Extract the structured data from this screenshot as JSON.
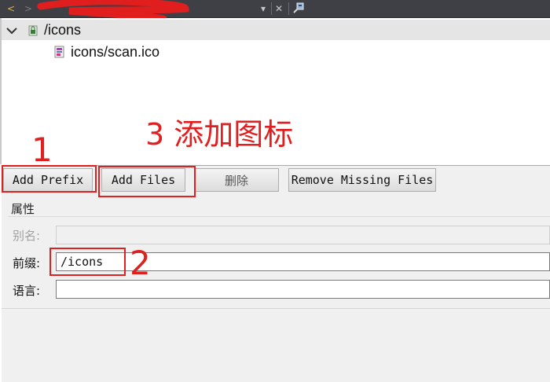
{
  "toolbar": {
    "back_glyph": "<",
    "forward_glyph": ">",
    "dropdown_glyph": "▾",
    "close_glyph": "✕"
  },
  "tree": {
    "prefix_label": "/icons",
    "file_label": "icons/scan.ico"
  },
  "buttons": {
    "add_prefix": "Add Prefix",
    "add_files": "Add Files",
    "delete": "删除",
    "remove_missing": "Remove Missing Files"
  },
  "properties": {
    "title": "属性",
    "alias_label": "别名:",
    "alias_value": "",
    "prefix_label": "前缀:",
    "prefix_value": "/icons",
    "language_label": "语言:",
    "language_value": ""
  },
  "annotations": {
    "step1": "1",
    "step2": "2",
    "step3": "3 添加图标",
    "color": "#e02020"
  },
  "colors": {
    "toolbar_bg": "#3f4046",
    "selection_bg": "#e5e5e5",
    "panel_bg": "#f0f0f0"
  }
}
